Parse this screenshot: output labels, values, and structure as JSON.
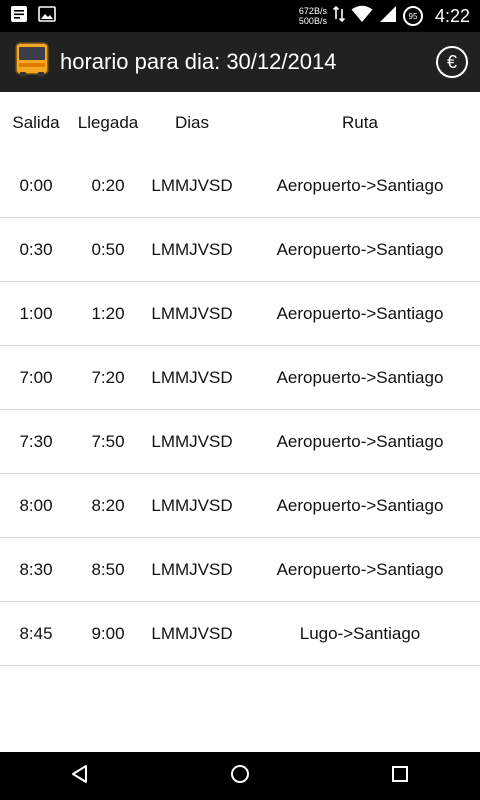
{
  "status_bar": {
    "net_up": "672B/s",
    "net_down": "500B/s",
    "battery": "95",
    "time": "4:22"
  },
  "app_bar": {
    "title": "horario para dia: 30/12/2014",
    "euro_symbol": "€"
  },
  "table": {
    "headers": [
      "Salida",
      "Llegada",
      "Dias",
      "Ruta"
    ],
    "rows": [
      [
        "0:00",
        "0:20",
        "LMMJVSD",
        "Aeropuerto->Santiago"
      ],
      [
        "0:30",
        "0:50",
        "LMMJVSD",
        "Aeropuerto->Santiago"
      ],
      [
        "1:00",
        "1:20",
        "LMMJVSD",
        "Aeropuerto->Santiago"
      ],
      [
        "7:00",
        "7:20",
        "LMMJVSD",
        "Aeropuerto->Santiago"
      ],
      [
        "7:30",
        "7:50",
        "LMMJVSD",
        "Aeropuerto->Santiago"
      ],
      [
        "8:00",
        "8:20",
        "LMMJVSD",
        "Aeropuerto->Santiago"
      ],
      [
        "8:30",
        "8:50",
        "LMMJVSD",
        "Aeropuerto->Santiago"
      ],
      [
        "8:45",
        "9:00",
        "LMMJVSD",
        "Lugo->Santiago"
      ]
    ]
  }
}
